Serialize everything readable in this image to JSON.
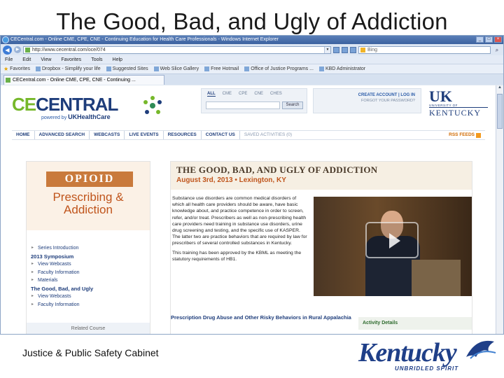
{
  "slide": {
    "title": "The Good, Bad, and Ugly of Addiction",
    "footer": "Justice & Public Safety Cabinet",
    "logo_word": "Kentucky",
    "logo_slogan": "UNBRIDLED SPIRIT"
  },
  "browser": {
    "window_title": "CECentral.com - Online CME, CPE, CNE - Continuing Education for Health Care Professionals - Windows Internet Explorer",
    "url": "http://www.cecentral.com/oce/074",
    "search_placeholder": "Bing",
    "menu": [
      "File",
      "Edit",
      "View",
      "Favorites",
      "Tools",
      "Help"
    ],
    "favorites": [
      "Favorites",
      "Dropbox - Simplify your life",
      "Suggested Sites",
      "Web Slice Gallery",
      "Free Hotmail",
      "Office of Justice Programs ...",
      "KBD Administrator"
    ],
    "tab_label": "CECentral.com - Online CME, CPE, CNE - Continuing ..."
  },
  "site": {
    "logo_ce": "CE",
    "logo_central": "CENTRAL",
    "powered_by": "powered by",
    "powered_brand": "UKHealthCare",
    "filter_tabs": [
      "ALL",
      "CME",
      "CPE",
      "CNE",
      "CHES"
    ],
    "search_button": "Search",
    "account_links": "CREATE ACCOUNT | LOG IN",
    "forgot_password": "FORGOT YOUR PASSWORD?",
    "uk_mark": "UK",
    "uk_university": "UNIVERSITY OF",
    "uk_kentucky": "KENTUCKY",
    "nav": [
      "HOME",
      "ADVANCED SEARCH",
      "WEBCASTS",
      "LIVE EVENTS",
      "RESOURCES",
      "CONTACT US"
    ],
    "saved_activities": "SAVED ACTIVITIES (0)",
    "rss": "RSS FEEDS"
  },
  "course": {
    "banner_word": "OPIOID",
    "banner_line1": "Prescribing &",
    "banner_line2": "Addiction",
    "menu": {
      "intro": "Series Introduction",
      "symposium": "2013 Symposium",
      "symposium_items": [
        "View Webcasts",
        "Faculty Information",
        "Materials"
      ],
      "gbu": "The Good, Bad, and Ugly",
      "gbu_items": [
        "View Webcasts",
        "Faculty Information"
      ]
    },
    "related": "Related Course"
  },
  "event": {
    "title": "THE GOOD, BAD, AND UGLY OF ADDICTION",
    "date": "August 3rd, 2013 • Lexington, KY",
    "description_1": "Substance use disorders are common medical disorders of which all health care providers should be aware, have basic knowledge about, and practice competence in order to screen, refer, and/or treat. Prescribers as well as non-prescribing health care providers need training in substance use disorders, urine drug screening and testing, and the specific use of KASPER. The latter two are practice behaviors that are required by law for prescribers of several controlled substances in Kentucky.",
    "description_2": "This training has been approved by the KBML as meeting the statutory requirements of HB1.",
    "next_course": "Prescription Drug Abuse and Other Risky Behaviors in Rural Appalachia",
    "activity_details": "Activity Details"
  }
}
